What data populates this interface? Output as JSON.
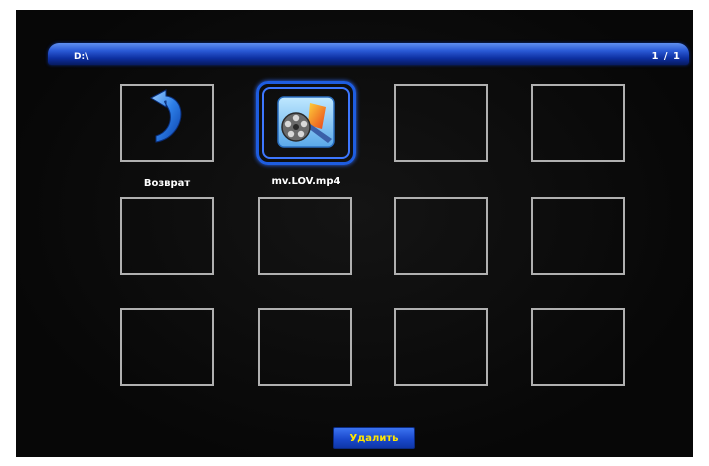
{
  "screen": {
    "path": "D:\\",
    "page_indicator": "1 / 1"
  },
  "grid": {
    "items": [
      {
        "label": "Возврат",
        "icon": "return-arrow-icon",
        "type": "back"
      },
      {
        "label": "mv.LOV.mp4",
        "icon": "video-file-icon",
        "type": "file",
        "selected": true
      }
    ]
  },
  "actions": {
    "delete_label": "Удалить"
  },
  "colors": {
    "accent_blue": "#1e5de0",
    "button_text": "#ffe600",
    "tile_border": "#b0b0b0"
  }
}
